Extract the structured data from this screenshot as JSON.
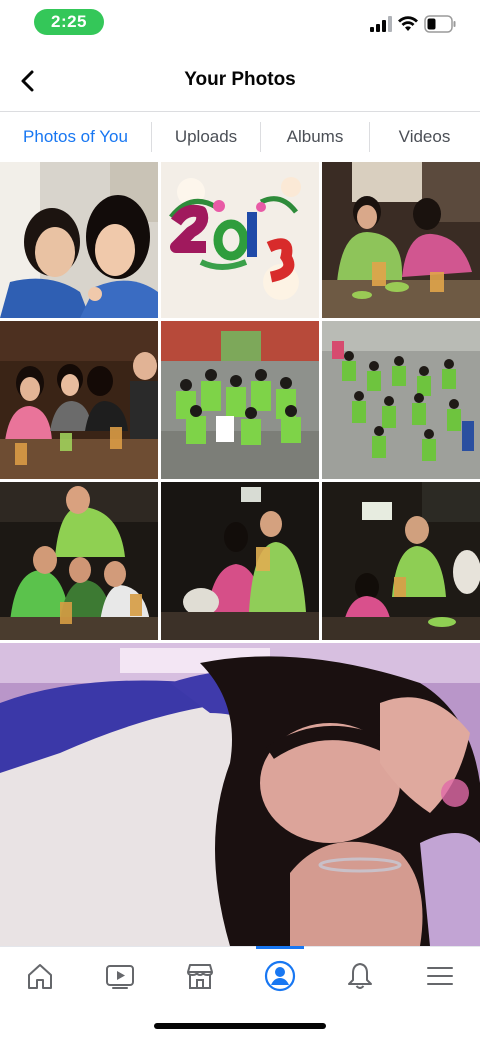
{
  "status_bar": {
    "time": "2:25",
    "time_pill_color": "#34c759",
    "icons": [
      "signal-icon",
      "wifi-icon",
      "battery-icon"
    ]
  },
  "header": {
    "title": "Your Photos",
    "back_icon": "chevron-left-icon"
  },
  "tabs": [
    {
      "label": "Photos of You",
      "active": true
    },
    {
      "label": "Uploads",
      "active": false
    },
    {
      "label": "Albums",
      "active": false
    },
    {
      "label": "Videos",
      "active": false
    }
  ],
  "colors": {
    "accent": "#1877f2",
    "tab_text": "#4b4f56",
    "divider": "#dcdde0"
  },
  "photos": [
    {
      "id": "photo-1",
      "depiction": "selfie-two-girls"
    },
    {
      "id": "photo-2",
      "depiction": "2013-floral-graphic"
    },
    {
      "id": "photo-3",
      "depiction": "group-at-cafe-table"
    },
    {
      "id": "photo-4",
      "depiction": "girls-at-restaurant"
    },
    {
      "id": "photo-5",
      "depiction": "group-green-shirts-outdoor"
    },
    {
      "id": "photo-6",
      "depiction": "group-green-shirts-high-angle"
    },
    {
      "id": "photo-7",
      "depiction": "group-drinking-at-night"
    },
    {
      "id": "photo-8",
      "depiction": "toast-at-night"
    },
    {
      "id": "photo-9",
      "depiction": "toast-at-night-2"
    },
    {
      "id": "photo-10",
      "depiction": "girl-sleeping-closeup"
    }
  ],
  "bottom_nav": [
    {
      "icon": "home-icon",
      "active": false
    },
    {
      "icon": "video-icon",
      "active": false
    },
    {
      "icon": "marketplace-icon",
      "active": false
    },
    {
      "icon": "profile-icon",
      "active": true
    },
    {
      "icon": "bell-icon",
      "active": false
    },
    {
      "icon": "menu-icon",
      "active": false
    }
  ]
}
